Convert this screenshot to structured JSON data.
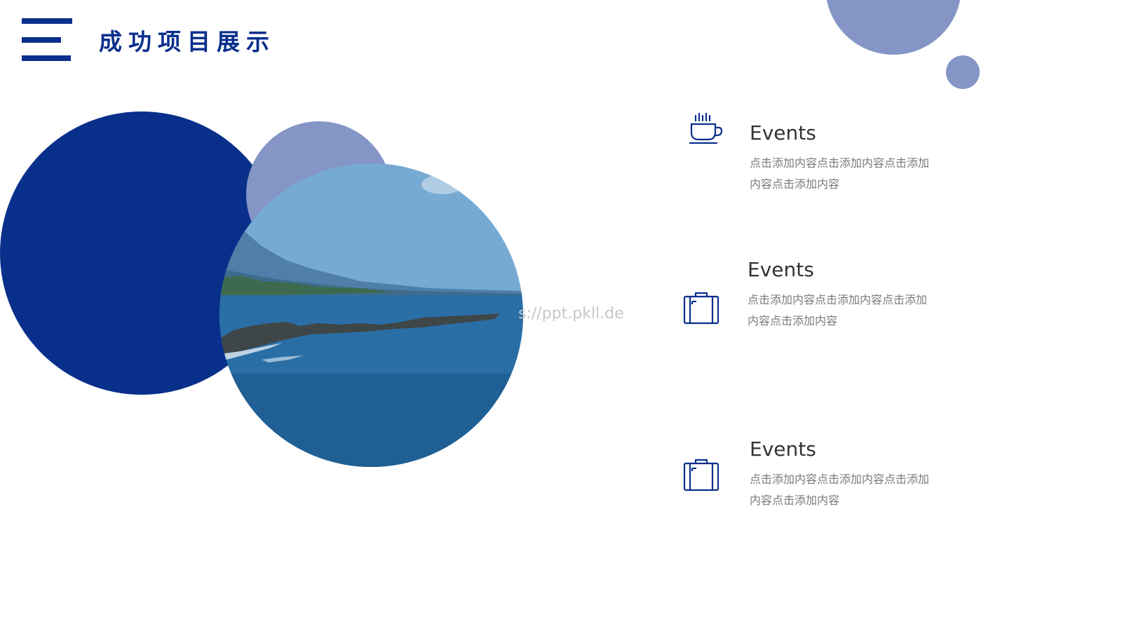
{
  "header": {
    "title": "成功项目展示"
  },
  "watermark": "s://ppt.pkll.de",
  "colors": {
    "primary": "#0a2f8c",
    "accent": "#8495c6",
    "title_text": "#333333",
    "body_text": "#7a7a7a"
  },
  "items": [
    {
      "icon": "coffee-cup-icon",
      "title": "Events",
      "description": "点击添加内容点击添加内容点击添加内容点击添加内容"
    },
    {
      "icon": "suitcase-icon",
      "title": "Events",
      "description": "点击添加内容点击添加内容点击添加内容点击添加内容"
    },
    {
      "icon": "suitcase-icon",
      "title": "Events",
      "description": "点击添加内容点击添加内容点击添加内容点击添加内容"
    }
  ]
}
